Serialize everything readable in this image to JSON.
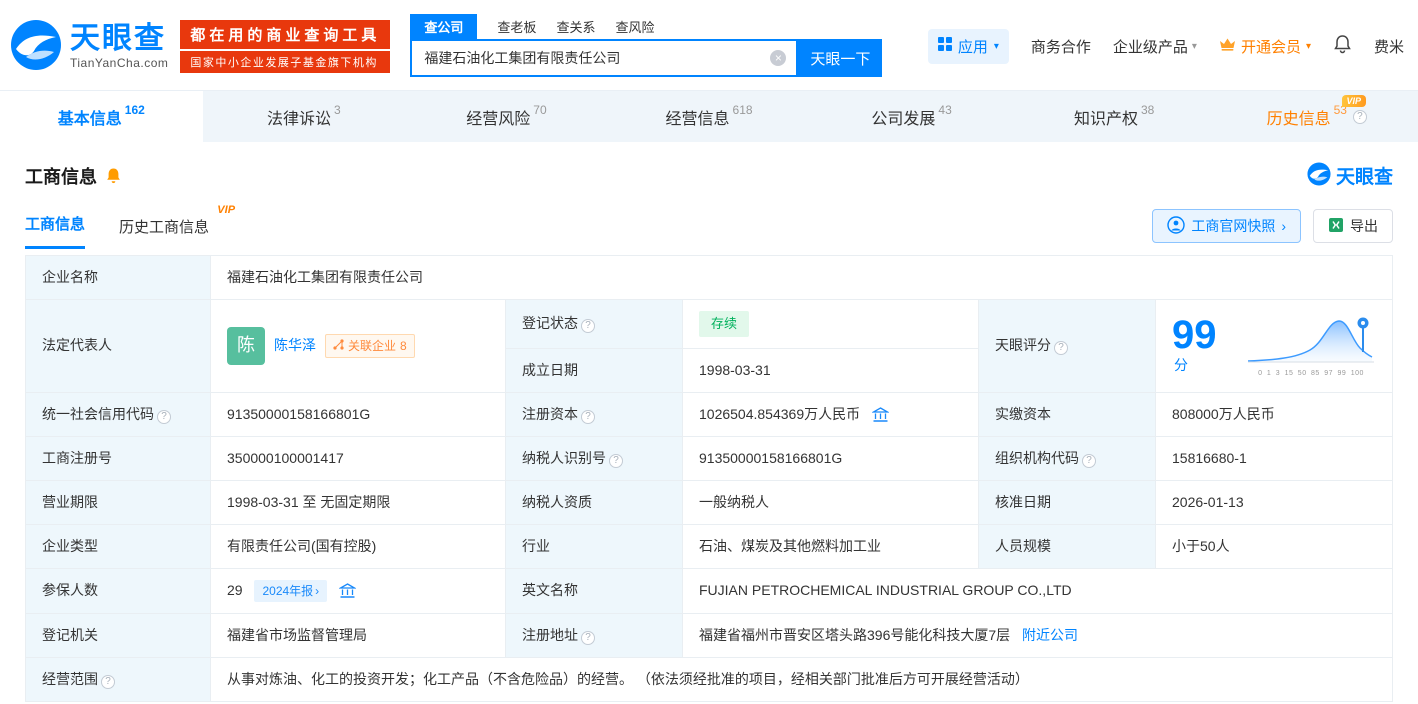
{
  "icons": {
    "caret_down": "▾",
    "clear_glyph": "×",
    "help_glyph": "?",
    "chevron_right": "›"
  },
  "header": {
    "logo": {
      "title": "天眼查",
      "subtitle": "TianYanCha.com"
    },
    "slogan": {
      "line1": "都在用的商业查询工具",
      "line2": "国家中小企业发展子基金旗下机构"
    },
    "search": {
      "tabs": [
        {
          "label": "查公司"
        },
        {
          "label": "查老板"
        },
        {
          "label": "查关系"
        },
        {
          "label": "查风险"
        }
      ],
      "value": "福建石油化工集团有限责任公司",
      "button": "天眼一下"
    },
    "nav": {
      "apps": "应用",
      "cooperation": "商务合作",
      "enterprise": "企业级产品",
      "vip": "开通会员",
      "user": "费米"
    }
  },
  "nav_tabs": [
    {
      "label": "基本信息",
      "count": "162"
    },
    {
      "label": "法律诉讼",
      "count": "3"
    },
    {
      "label": "经营风险",
      "count": "70"
    },
    {
      "label": "经营信息",
      "count": "618"
    },
    {
      "label": "公司发展",
      "count": "43"
    },
    {
      "label": "知识产权",
      "count": "38"
    },
    {
      "label": "历史信息",
      "count": "53",
      "vip": "VIP"
    }
  ],
  "biz": {
    "section_title": "工商信息",
    "brand": "天眼查",
    "subtabs": [
      {
        "label": "工商信息"
      },
      {
        "label": "历史工商信息",
        "vip": "VIP"
      }
    ],
    "snapshot_button": "工商官网快照",
    "export_button": "导出",
    "fields": {
      "company_name": {
        "label": "企业名称",
        "value": "福建石油化工集团有限责任公司"
      },
      "legal_rep": {
        "label": "法定代表人",
        "avatar": "陈",
        "name": "陈华泽",
        "related_badge": "关联企业",
        "related_count": "8"
      },
      "reg_status": {
        "label": "登记状态",
        "value": "存续"
      },
      "establish_date": {
        "label": "成立日期",
        "value": "1998-03-31"
      },
      "score": {
        "label": "天眼评分",
        "value": "99",
        "unit": "分",
        "axis": "0 1 3 15 50 85 97 99 100"
      },
      "credit_code": {
        "label": "统一社会信用代码",
        "value": "91350000158166801G"
      },
      "reg_capital": {
        "label": "注册资本",
        "value": "1026504.854369万人民币"
      },
      "paid_capital": {
        "label": "实缴资本",
        "value": "808000万人民币"
      },
      "reg_number": {
        "label": "工商注册号",
        "value": "350000100001417"
      },
      "taxpayer_id": {
        "label": "纳税人识别号",
        "value": "91350000158166801G"
      },
      "org_code": {
        "label": "组织机构代码",
        "value": "15816680-1"
      },
      "business_term": {
        "label": "营业期限",
        "value": "1998-03-31 至 无固定期限"
      },
      "taxpayer_quality": {
        "label": "纳税人资质",
        "value": "一般纳税人"
      },
      "approval_date": {
        "label": "核准日期",
        "value": "2026-01-13"
      },
      "company_type": {
        "label": "企业类型",
        "value": "有限责任公司(国有控股)"
      },
      "industry": {
        "label": "行业",
        "value": "石油、煤炭及其他燃料加工业"
      },
      "staff_size": {
        "label": "人员规模",
        "value": "小于50人"
      },
      "insured_count": {
        "label": "参保人数",
        "value": "29",
        "badge": "2024年报"
      },
      "english_name": {
        "label": "英文名称",
        "value": "FUJIAN PETROCHEMICAL INDUSTRIAL GROUP CO.,LTD"
      },
      "reg_authority": {
        "label": "登记机关",
        "value": "福建省市场监督管理局"
      },
      "reg_address": {
        "label": "注册地址",
        "value": "福建省福州市晋安区塔头路396号能化科技大厦7层",
        "link": "附近公司"
      },
      "business_scope": {
        "label": "经营范围",
        "value": "从事对炼油、化工的投资开发；化工产品（不含危险品）的经营。 （依法须经批准的项目，经相关部门批准后方可开展经营活动）"
      }
    }
  }
}
